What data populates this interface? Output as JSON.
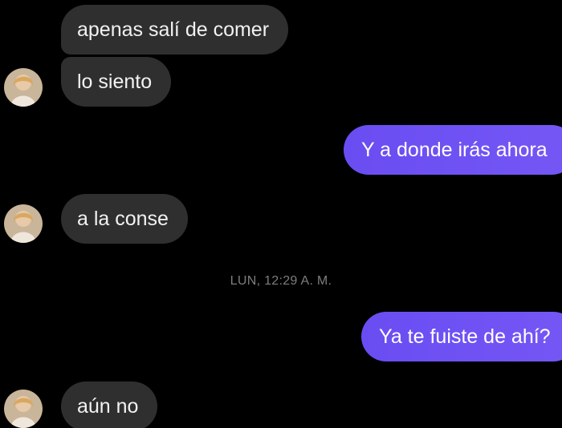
{
  "conversation": {
    "messages": [
      {
        "direction": "incoming",
        "text": "apenas salí de comer"
      },
      {
        "direction": "incoming",
        "text": "lo siento"
      },
      {
        "direction": "outgoing",
        "text": "Y a donde irás ahora"
      },
      {
        "direction": "incoming",
        "text": "a la conse"
      },
      {
        "direction": "outgoing",
        "text": "Ya te fuiste de ahí?"
      },
      {
        "direction": "incoming",
        "text": "aún no"
      }
    ],
    "timestamp_divider": "LUN, 12:29 A. M."
  },
  "colors": {
    "background": "#000000",
    "incoming_bubble": "#2f2f2f",
    "outgoing_bubble": "#7052f4",
    "timestamp_text": "#7d7d7d"
  },
  "icons": {
    "contact_avatar": "contact-avatar-icon"
  }
}
